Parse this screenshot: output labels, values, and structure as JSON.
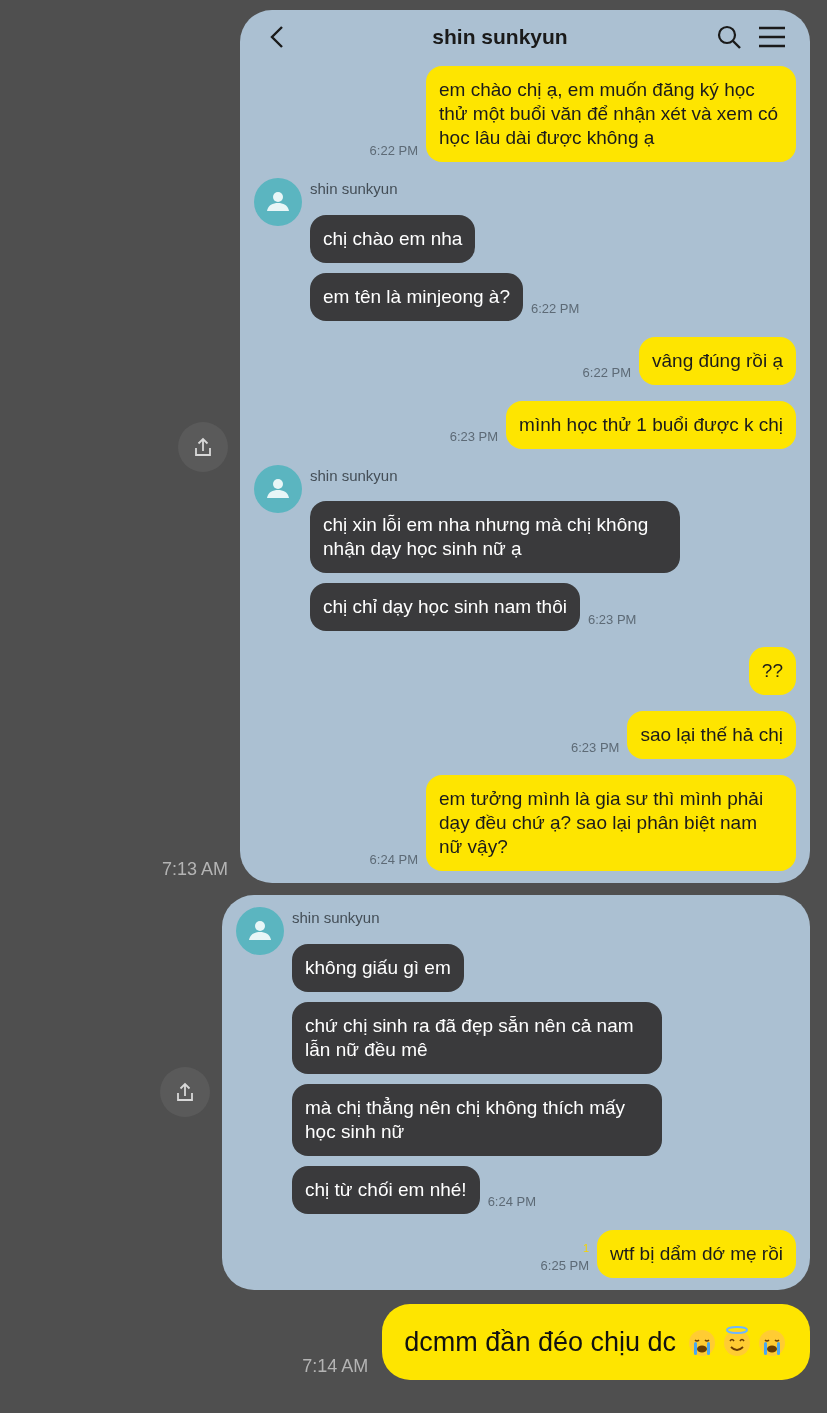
{
  "messages": [
    {
      "kind": "screenshot",
      "time": "7:13 AM",
      "header": {
        "title": "shin sunkyun"
      },
      "chat": [
        {
          "kind": "out",
          "bubbles": [
            "em chào chị ạ, em muốn đăng ký học thử một buổi văn để nhận xét và xem có học lâu dài được không ạ"
          ],
          "time": "6:22 PM"
        },
        {
          "kind": "in",
          "sender": "shin sunkyun",
          "bubbles": [
            "chị chào em nha",
            "em tên là minjeong à?"
          ],
          "time": "6:22 PM"
        },
        {
          "kind": "out",
          "bubbles": [
            "vâng đúng rồi ạ"
          ],
          "time": "6:22 PM"
        },
        {
          "kind": "out",
          "bubbles": [
            "mình học thử 1 buổi được k chị"
          ],
          "time": "6:23 PM"
        },
        {
          "kind": "in",
          "sender": "shin sunkyun",
          "bubbles": [
            "chị xin lỗi em nha nhưng mà chị không nhận dạy học sinh nữ ạ",
            "chị chỉ dạy học sinh nam thôi"
          ],
          "time": "6:23 PM"
        },
        {
          "kind": "out",
          "bubbles": [
            "??"
          ]
        },
        {
          "kind": "out",
          "bubbles": [
            "sao lại thế hả chị"
          ],
          "time": "6:23 PM"
        },
        {
          "kind": "out",
          "bubbles": [
            "em tưởng mình là gia sư thì mình phải dạy đều chứ ạ? sao lại phân biệt nam nữ vậy?"
          ],
          "time": "6:24 PM"
        }
      ]
    },
    {
      "kind": "screenshot",
      "chat": [
        {
          "kind": "in",
          "sender": "shin sunkyun",
          "bubbles": [
            "không giấu gì em",
            "chứ chị sinh ra đã đẹp sẵn nên cả nam lẫn nữ đều mê",
            "mà chị thẳng nên chị không thích mấy học sinh nữ",
            "chị từ chối em nhé!"
          ],
          "time": "6:24 PM"
        },
        {
          "kind": "out",
          "bubbles": [
            "wtf bị dẩm dớ mẹ rồi"
          ],
          "time": "6:25 PM",
          "unread": "1"
        }
      ]
    },
    {
      "kind": "text",
      "time": "7:14 AM",
      "text": "dcmm đần đéo chịu dc"
    }
  ]
}
